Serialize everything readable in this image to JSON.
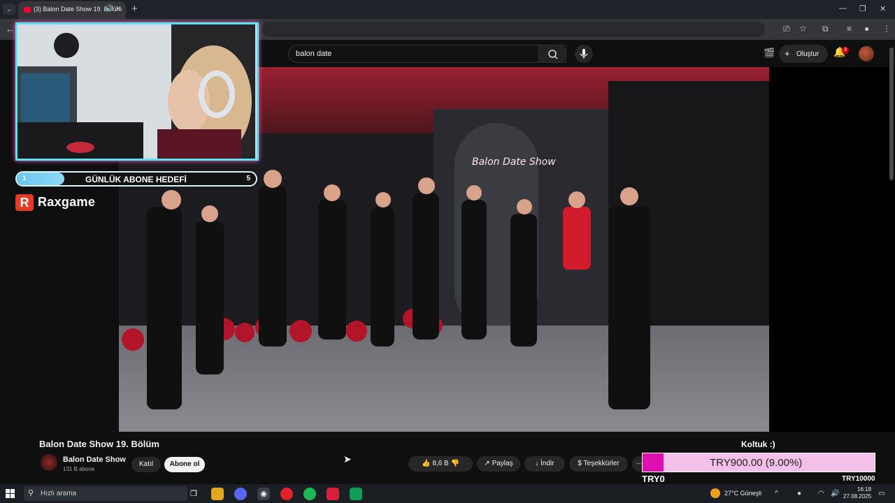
{
  "browser": {
    "tab_title": "(3) Balon Date Show 19. Bölüm",
    "tab_close": "✕",
    "new_tab": "+",
    "win_min": "—",
    "win_max": "❐",
    "win_close": "✕"
  },
  "youtube": {
    "search_query": "balon date",
    "create_label": "Oluştur",
    "notifications_count": "3"
  },
  "stream_overlay": {
    "goal_current": "1",
    "goal_label": "GÜNLÜK ABONE HEDEFİ",
    "goal_target": "5",
    "goal_progress": 0.2,
    "brand_letter": "R",
    "brand_name": "Raxgame",
    "neon_sign": "Balon Date Show"
  },
  "video": {
    "title": "Balon Date Show 19. Bölüm",
    "channel_name": "Balon Date Show",
    "subscribers": "131 B abone",
    "join_label": "Katıl",
    "subscribe_label": "Abone ol",
    "likes": "8,6 B",
    "share_label": "Paylaş",
    "download_label": "İndir",
    "thanks_label": "Teşekkürler",
    "more_label": "···"
  },
  "donation": {
    "title": "Koltuk :)",
    "amount_text": "TRY900.00 (9.00%)",
    "progress": 0.09,
    "min_label": "TRY0",
    "max_label": "TRY10000"
  },
  "taskbar": {
    "search_placeholder": "Hızlı arama",
    "weather": "27°C  Güneşli",
    "time": "16:18",
    "date": "27.08.2025"
  },
  "colors": {
    "accent_red": "#ff0033",
    "goal_fill": "#6ac8ef",
    "donation_fill": "#e010b0",
    "donation_bg": "#f4c0ea"
  }
}
